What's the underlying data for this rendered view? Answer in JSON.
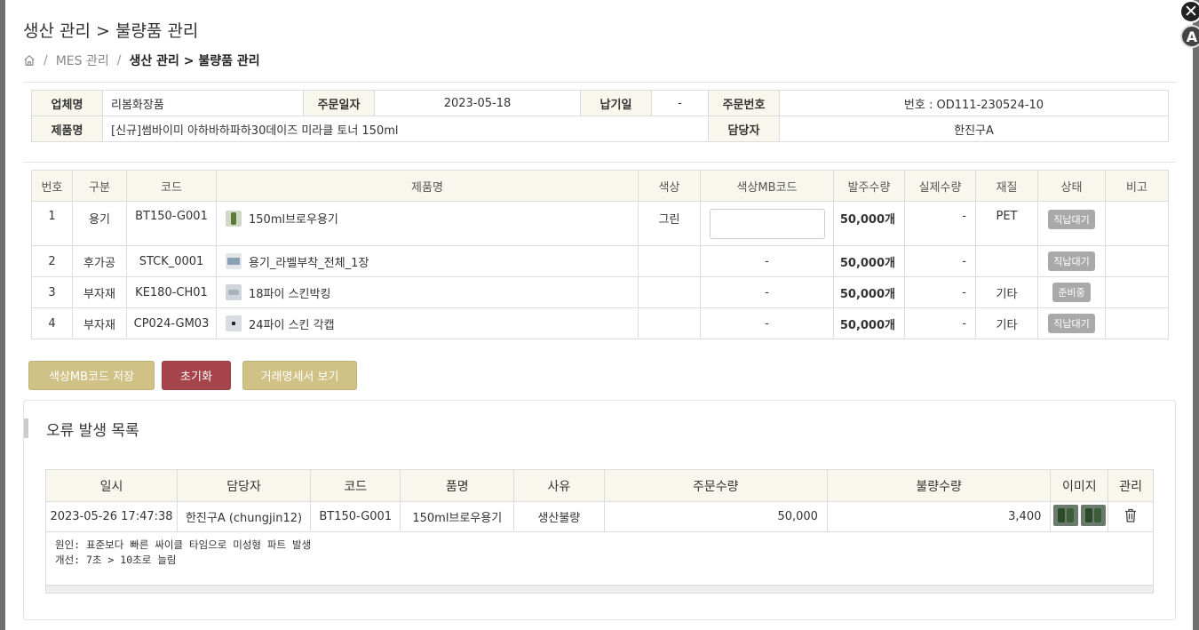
{
  "page_title": "생산 관리 > 불량품 관리",
  "breadcrumb": {
    "sep": "/",
    "parent": "MES 관리",
    "current": "생산 관리 > 불량품 관리"
  },
  "order_info": {
    "company_label": "업체명",
    "company": "리봄화장품",
    "order_date_label": "주문일자",
    "order_date": "2023-05-18",
    "delivery_label": "납기일",
    "delivery": "-",
    "order_no_label": "주문번호",
    "order_no": "번호 : OD111-230524-10",
    "product_label": "제품명",
    "product": "[신규]썸바이미 아하바하파하30데이즈 미라클 토너 150ml",
    "manager_label": "담당자",
    "manager": "한진구A"
  },
  "items": {
    "headers": [
      "번호",
      "구분",
      "코드",
      "제품명",
      "색상",
      "색상MB코드",
      "발주수량",
      "실제수량",
      "재질",
      "상태",
      "비고"
    ],
    "rows": [
      {
        "no": "1",
        "type": "용기",
        "code": "BT150-G001",
        "name": "150ml브로우용기",
        "icon": "bottle-thumb",
        "color": "그린",
        "mb": "",
        "order_qty": "50,000개",
        "real_qty": "-",
        "material": "PET",
        "status": "직납대기",
        "memo": ""
      },
      {
        "no": "2",
        "type": "후가공",
        "code": "STCK_0001",
        "name": "용기_라벨부착_전체_1장",
        "icon": "printer-thumb",
        "color": "",
        "mb": "-",
        "order_qty": "50,000개",
        "real_qty": "-",
        "material": "",
        "status": "직납대기",
        "memo": ""
      },
      {
        "no": "3",
        "type": "부자재",
        "code": "KE180-CH01",
        "name": "18파이 스킨박킹",
        "icon": "packing-thumb",
        "color": "",
        "mb": "-",
        "order_qty": "50,000개",
        "real_qty": "-",
        "material": "기타",
        "status": "준비중",
        "memo": ""
      },
      {
        "no": "4",
        "type": "부자재",
        "code": "CP024-GM03",
        "name": "24파이 스킨 각캡",
        "icon": "cap-thumb",
        "color": "",
        "mb": "-",
        "order_qty": "50,000개",
        "real_qty": "-",
        "material": "기타",
        "status": "직납대기",
        "memo": ""
      }
    ]
  },
  "buttons": {
    "save_mb": "색상MB코드 저장",
    "reset": "초기화",
    "statement": "거래명세서 보기"
  },
  "errors": {
    "title": "오류 발생 목록",
    "headers": [
      "일시",
      "담당자",
      "코드",
      "품명",
      "사유",
      "주문수량",
      "불량수량",
      "이미지",
      "관리"
    ],
    "rows": [
      {
        "datetime": "2023-05-26 17:47:38",
        "manager": "한진구A (chungjin12)",
        "code": "BT150-G001",
        "name": "150ml브로우용기",
        "reason": "생산불량",
        "order_qty": "50,000",
        "defect_qty": "3,400",
        "cause": "원인: 표준보다 빠른 싸이클 타임으로 미성형 파트 발생",
        "fix": "개선: 7초 > 10초로 늘림"
      }
    ]
  },
  "colors": {
    "header_bg": "#f8f7ee",
    "gold_button": "#d0c186",
    "red_button": "#a6444b",
    "badge": "#a9a9a9"
  },
  "icons": {
    "close": "close-icon",
    "home": "home-icon",
    "delete": "trash-icon",
    "a_button": "A"
  }
}
